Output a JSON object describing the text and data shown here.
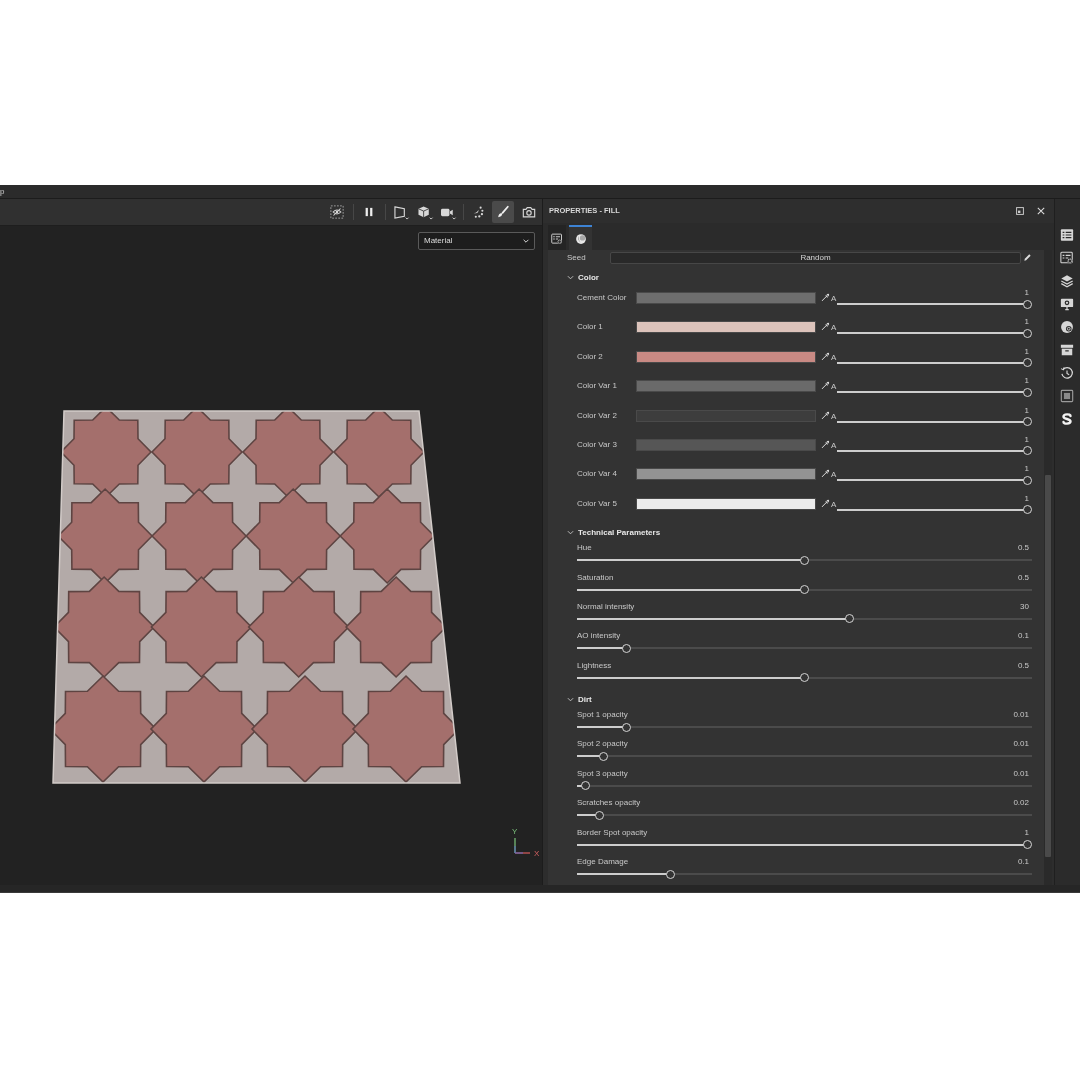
{
  "title_bar": {
    "text": "p"
  },
  "viewport": {
    "toolbar": [
      {
        "selected": false
      },
      {
        "selected": false
      },
      {
        "selected": false
      },
      {
        "selected": false
      },
      {
        "selected": false
      },
      {
        "selected": false
      },
      {
        "selected": true
      },
      {
        "selected": false
      }
    ],
    "view_mode": {
      "value": "Material"
    },
    "axis_gizmo": {
      "y_label": "Y",
      "x_label": "X"
    }
  },
  "properties": {
    "title": "PROPERTIES - FILL",
    "tabs": [
      {
        "selected": false
      },
      {
        "selected": true
      }
    ],
    "seed": {
      "label": "Seed",
      "button": "Random"
    },
    "sections": [
      {
        "title": "Color",
        "expanded": true,
        "rows": [
          {
            "kind": "color",
            "label": "Cement Color",
            "color": "#6e6e6e",
            "alpha_label": "A",
            "reading": "1",
            "level": 1
          },
          {
            "kind": "color",
            "label": "Color 1",
            "color": "#dcc3bb",
            "alpha_label": "A",
            "reading": "1",
            "level": 1
          },
          {
            "kind": "color",
            "label": "Color 2",
            "color": "#c98a84",
            "alpha_label": "A",
            "reading": "1",
            "level": 1
          },
          {
            "kind": "color",
            "label": "Color Var 1",
            "color": "#6a6a6a",
            "alpha_label": "A",
            "reading": "1",
            "level": 1
          },
          {
            "kind": "color",
            "label": "Color Var 2",
            "color": "#3d3d3d",
            "alpha_label": "A",
            "reading": "1",
            "level": 1
          },
          {
            "kind": "color",
            "label": "Color Var 3",
            "color": "#565656",
            "alpha_label": "A",
            "reading": "1",
            "level": 1
          },
          {
            "kind": "color",
            "label": "Color Var 4",
            "color": "#939393",
            "alpha_label": "A",
            "reading": "1",
            "level": 1
          },
          {
            "kind": "color",
            "label": "Color Var 5",
            "color": "#ececec",
            "alpha_label": "A",
            "reading": "1",
            "level": 1
          }
        ]
      },
      {
        "title": "Technical Parameters",
        "expanded": true,
        "rows": [
          {
            "kind": "slider",
            "label": "Hue",
            "reading": "0.5",
            "level": 0.5
          },
          {
            "kind": "slider",
            "label": "Saturation",
            "reading": "0.5",
            "level": 0.5
          },
          {
            "kind": "slider",
            "label": "Normal intensity",
            "reading": "30",
            "level": 0.6
          },
          {
            "kind": "slider",
            "label": "AO intensity",
            "reading": "0.1",
            "level": 0.1
          },
          {
            "kind": "slider",
            "label": "Lightness",
            "reading": "0.5",
            "level": 0.5
          }
        ]
      },
      {
        "title": "Dirt",
        "expanded": true,
        "rows": [
          {
            "kind": "slider",
            "label": "Spot 1 opacity",
            "reading": "0.01",
            "level": 0.1
          },
          {
            "kind": "slider",
            "label": "Spot 2 opacity",
            "reading": "0.01",
            "level": 0.05
          },
          {
            "kind": "slider",
            "label": "Spot 3 opacity",
            "reading": "0.01",
            "level": 0.01
          },
          {
            "kind": "slider",
            "label": "Scratches opacity",
            "reading": "0.02",
            "level": 0.04
          },
          {
            "kind": "slider",
            "label": "Border Spot opacity",
            "reading": "1",
            "level": 1
          },
          {
            "kind": "slider",
            "label": "Edge Damage",
            "reading": "0.1",
            "level": 0.2
          }
        ]
      }
    ]
  }
}
